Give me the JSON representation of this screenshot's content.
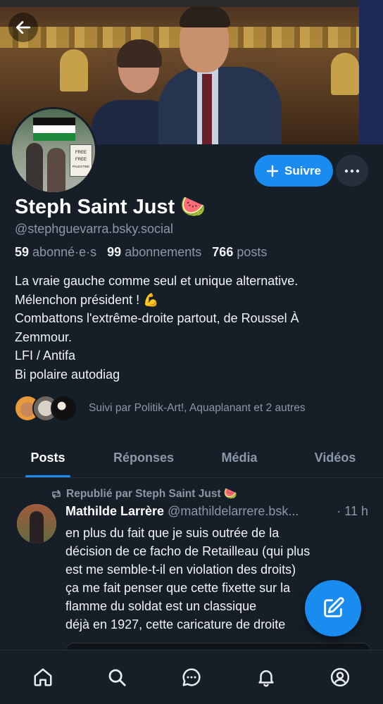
{
  "profile": {
    "display_name": "Steph Saint Just 🍉",
    "handle": "@stephguevarra.bsky.social",
    "stats": {
      "followers_count": "59",
      "followers_label": "abonné·e·s",
      "following_count": "99",
      "following_label": "abonnements",
      "posts_count": "766",
      "posts_label": "posts"
    },
    "bio": [
      "La vraie gauche comme seul et unique alternative.",
      "Mélenchon président ! 💪",
      "Combattons l'extrême-droite partout, de Roussel À",
      "Zemmour.",
      "LFI / Antifa",
      "Bi polaire autodiag"
    ],
    "avatar_sign_text": "FREE FREE PALESTINE",
    "followed_by": "Suivi par Politik-Art!, Aquaplanant et 2 autres"
  },
  "actions": {
    "follow_label": "Suivre"
  },
  "tabs": [
    {
      "label": "Posts",
      "active": true
    },
    {
      "label": "Réponses",
      "active": false
    },
    {
      "label": "Média",
      "active": false
    },
    {
      "label": "Vidéos",
      "active": false
    }
  ],
  "feed": {
    "repost_label": "Republié par Steph Saint Just 🍉",
    "post": {
      "author": "Mathilde Larrère",
      "handle": "@mathildelarrere.bsk...",
      "time": "· 11 h",
      "lines": [
        "en plus du fait que je suis outrée de la",
        "décision de ce facho de Retailleau (qui plus",
        "est me semble-t-il en violation des droits)",
        "ça me fait penser que cette fixette sur la",
        "flamme du soldat est un classique",
        "déjà en 1927, cette caricature de droite"
      ]
    }
  },
  "nav": {
    "items": [
      "home-icon",
      "search-icon",
      "chat-icon",
      "bell-icon",
      "profile-icon"
    ]
  },
  "colors": {
    "background": "#161e27",
    "accent": "#1a8cf0",
    "muted_text": "#8b98a8"
  }
}
